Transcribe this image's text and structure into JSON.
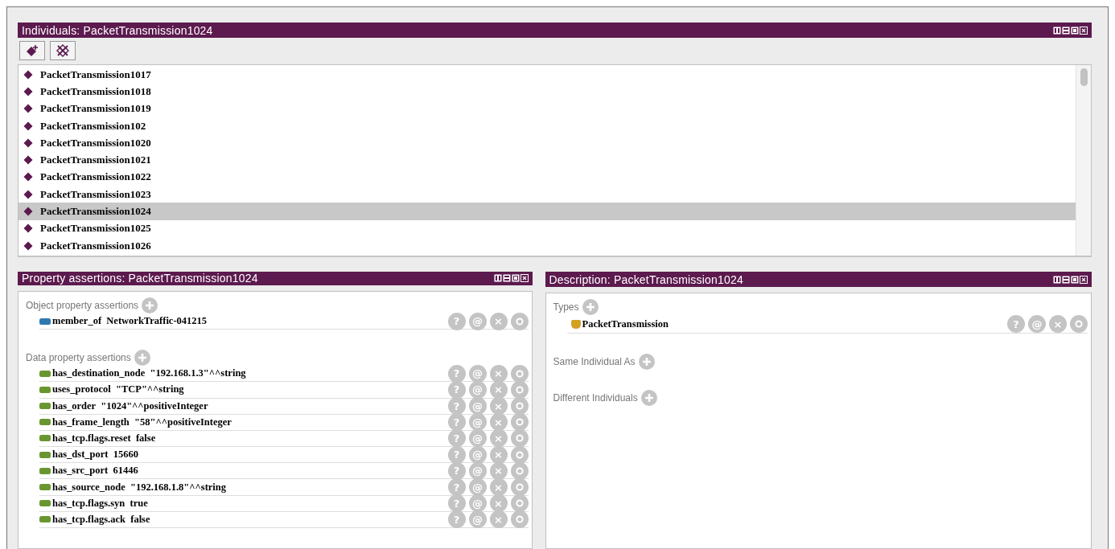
{
  "individuals": {
    "title": "Individuals: PacketTransmission1024",
    "items": [
      {
        "label": "PacketTransmission1017",
        "selected": false
      },
      {
        "label": "PacketTransmission1018",
        "selected": false
      },
      {
        "label": "PacketTransmission1019",
        "selected": false
      },
      {
        "label": "PacketTransmission102",
        "selected": false
      },
      {
        "label": "PacketTransmission1020",
        "selected": false
      },
      {
        "label": "PacketTransmission1021",
        "selected": false
      },
      {
        "label": "PacketTransmission1022",
        "selected": false
      },
      {
        "label": "PacketTransmission1023",
        "selected": false
      },
      {
        "label": "PacketTransmission1024",
        "selected": true
      },
      {
        "label": "PacketTransmission1025",
        "selected": false
      },
      {
        "label": "PacketTransmission1026",
        "selected": false
      }
    ]
  },
  "property_assertions": {
    "title": "Property assertions: PacketTransmission1024",
    "sections": [
      {
        "label": "Object property assertions",
        "rows": [
          {
            "kind": "object",
            "text": "member_of  NetworkTraffic-041215",
            "actions": [
              "?",
              "@",
              "×"
            ]
          }
        ]
      },
      {
        "label": "Data property assertions",
        "rows": [
          {
            "kind": "data",
            "text": "has_destination_node  \"192.168.1.3\"^^string",
            "actions": [
              "?",
              "@",
              "×"
            ]
          },
          {
            "kind": "data",
            "text": "uses_protocol  \"TCP\"^^string",
            "actions": [
              "?",
              "@",
              "×"
            ]
          },
          {
            "kind": "data",
            "text": "has_order  \"1024\"^^positiveInteger",
            "actions": [
              "?",
              "@",
              "×"
            ]
          },
          {
            "kind": "data",
            "text": "has_frame_length  \"58\"^^positiveInteger",
            "actions": [
              "?",
              "@",
              "×"
            ]
          },
          {
            "kind": "data",
            "text": "has_tcp.flags.reset  false",
            "actions": [
              "?",
              "@",
              "×"
            ]
          },
          {
            "kind": "data",
            "text": "has_dst_port  15660",
            "actions": [
              "?",
              "@",
              "×"
            ]
          },
          {
            "kind": "data",
            "text": "has_src_port  61446",
            "actions": [
              "?",
              "@",
              "×"
            ]
          },
          {
            "kind": "data",
            "text": "has_source_node  \"192.168.1.8\"^^string",
            "actions": [
              "?",
              "@",
              "×"
            ]
          },
          {
            "kind": "data",
            "text": "has_tcp.flags.syn  true",
            "actions": [
              "?",
              "@",
              "×"
            ]
          },
          {
            "kind": "data",
            "text": "has_tcp.flags.ack  false",
            "actions": [
              "?",
              "@",
              "×"
            ]
          }
        ]
      }
    ]
  },
  "description": {
    "title": "Description: PacketTransmission1024",
    "sections": [
      {
        "label": "Types",
        "rows": [
          {
            "kind": "class",
            "text": "PacketTransmission",
            "actions": [
              "?",
              "@",
              "×"
            ]
          }
        ]
      },
      {
        "label": "Same Individual As"
      },
      {
        "label": "Different Individuals"
      }
    ]
  }
}
